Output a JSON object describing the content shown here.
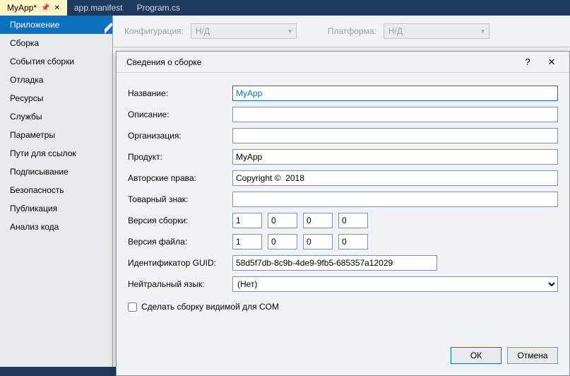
{
  "tabs": [
    {
      "label": "MyApp*",
      "active": true,
      "pinned": true
    },
    {
      "label": "app.manifest",
      "active": false
    },
    {
      "label": "Program.cs",
      "active": false
    }
  ],
  "sidebar": {
    "items": [
      "Приложение",
      "Сборка",
      "События сборки",
      "Отладка",
      "Ресурсы",
      "Службы",
      "Параметры",
      "Пути для ссылок",
      "Подписывание",
      "Безопасность",
      "Публикация",
      "Анализ кода"
    ],
    "selected": 0
  },
  "config": {
    "label_configuration": "Конфигурация:",
    "value_configuration": "Н/Д",
    "label_platform": "Платформа:",
    "value_platform": "Н/Д"
  },
  "dialog": {
    "title": "Сведения о сборке",
    "labels": {
      "name": "Название:",
      "description": "Описание:",
      "company": "Организация:",
      "product": "Продукт:",
      "copyright": "Авторские права:",
      "trademark": "Товарный знак:",
      "assembly_version": "Версия сборки:",
      "file_version": "Версия файла:",
      "guid": "Идентификатор GUID:",
      "language": "Нейтральный язык:",
      "com_visible": "Сделать сборку видимой для COM"
    },
    "values": {
      "name": "MyApp",
      "description": "",
      "company": "",
      "product": "MyApp",
      "copyright": "Copyright ©  2018",
      "trademark": "",
      "assembly_version": [
        "1",
        "0",
        "0",
        "0"
      ],
      "file_version": [
        "1",
        "0",
        "0",
        "0"
      ],
      "guid": "58d5f7db-8c9b-4de9-9fb5-685357a12029",
      "language": "(Нет)",
      "com_visible": false
    },
    "buttons": {
      "ok": "ОК",
      "cancel": "Отмена"
    }
  }
}
